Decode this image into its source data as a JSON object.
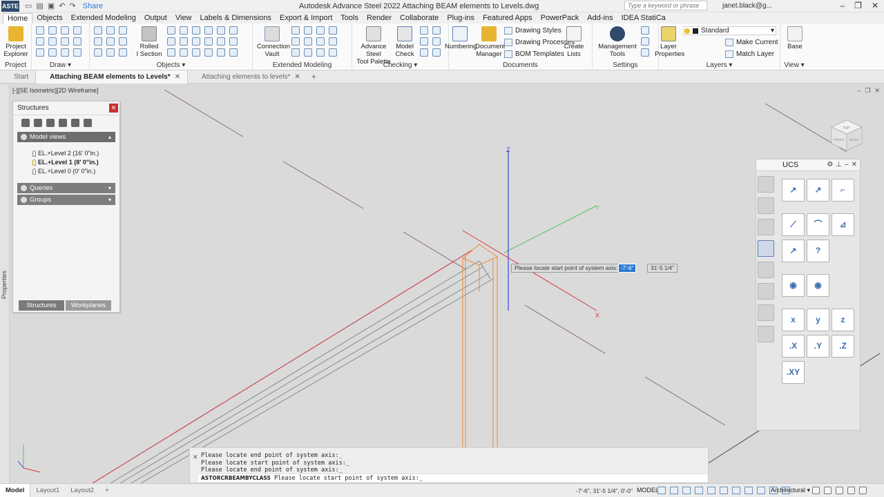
{
  "titlebar": {
    "logo": "ASTE",
    "share": "Share",
    "title": "Autodesk Advance Steel 2022   Attaching BEAM elements to Levels.dwg",
    "search_placeholder": "Type a keyword or phrase",
    "user": "janet.black@g..."
  },
  "menu_tabs": [
    "Home",
    "Objects",
    "Extended Modeling",
    "Output",
    "View",
    "Labels & Dimensions",
    "Export & Import",
    "Tools",
    "Render",
    "Collaborate",
    "Plug-ins",
    "Featured Apps",
    "PowerPack",
    "Add-ins",
    "IDEA StatiCa"
  ],
  "ribbon": {
    "groups": {
      "project": "Project",
      "draw": "Draw",
      "objects": "Objects",
      "extended": "Extended Modeling",
      "checking": "Checking",
      "documents": "Documents",
      "settings": "Settings",
      "layers": "Layers",
      "view": "View"
    },
    "buttons": {
      "project_explorer_1": "Project",
      "project_explorer_2": "Explorer",
      "rolled_section_1": "Rolled",
      "rolled_section_2": "I Section",
      "connection_vault_1": "Connection",
      "connection_vault_2": "Vault",
      "tool_palette_1": "Advance Steel",
      "tool_palette_2": "Tool Palette",
      "model_check_1": "Model",
      "model_check_2": "Check",
      "numbering": "Numbering",
      "document_manager_1": "Document",
      "document_manager_2": "Manager",
      "drawing_styles": "Drawing Styles",
      "drawing_processes": "Drawing Processes",
      "bom_templates": "BOM Templates",
      "create_lists_1": "Create",
      "create_lists_2": "Lists",
      "management_tools_1": "Management",
      "management_tools_2": "Tools",
      "layer_properties_1": "Layer",
      "layer_properties_2": "Properties",
      "layer_name": "Standard",
      "make_current": "Make Current",
      "match_layer": "Match Layer",
      "base": "Base"
    }
  },
  "doc_tabs": {
    "start": "Start",
    "tab1": "Attaching BEAM elements to Levels*",
    "tab2": "Attaching elements to levels*"
  },
  "viewport": {
    "view_label": "[-][SE Isometric][2D Wireframe]",
    "axis_x": "X",
    "axis_y": "Y",
    "axis_z": "Z",
    "viewcube_top": "TOP",
    "viewcube_front": "FRONT",
    "viewcube_right": "RIGHT"
  },
  "structures": {
    "title": "Structures",
    "model_views": "Model views",
    "levels": [
      {
        "label": "EL.+Level 2 (16' 0\"in.)",
        "current": false
      },
      {
        "label": "EL.+Level 1 (8' 0\"in.)",
        "current": true
      },
      {
        "label": "EL.+Level 0 (0' 0\"in.)",
        "current": false
      }
    ],
    "queries": "Queries",
    "groups": "Groups",
    "tab_structures": "Structures",
    "tab_workplanes": "Workplanes"
  },
  "ucs": {
    "title": "UCS",
    "btn_x": ".X",
    "btn_y": ".Y",
    "btn_z": ".Z",
    "btn_xy": ".XY"
  },
  "dynamic_input": {
    "prompt": "Please locate start point of system axis:",
    "value1": "-7'-6\"",
    "value2": "31'-5 1/4\""
  },
  "command": {
    "history": [
      "Please locate end point of system axis:_",
      "Please locate start point of system axis:_",
      "Please locate end point of system axis:_"
    ],
    "cmd_name": "ASTORCRBEAMBYCLASS",
    "current": "Please locate start point of system axis:_"
  },
  "status": {
    "model_tab": "Model",
    "layout1": "Layout1",
    "layout2": "Layout2",
    "coords": "-7'-6\", 31'-5 1/4\", 0'-0\"",
    "model": "MODEL",
    "units": "Architectural"
  },
  "colors": {
    "accent": "#2e7bd4",
    "x_axis": "#d9353a",
    "y_axis": "#4fc65a",
    "z_axis": "#3f45d6",
    "beam_orange": "#f08a2a"
  }
}
